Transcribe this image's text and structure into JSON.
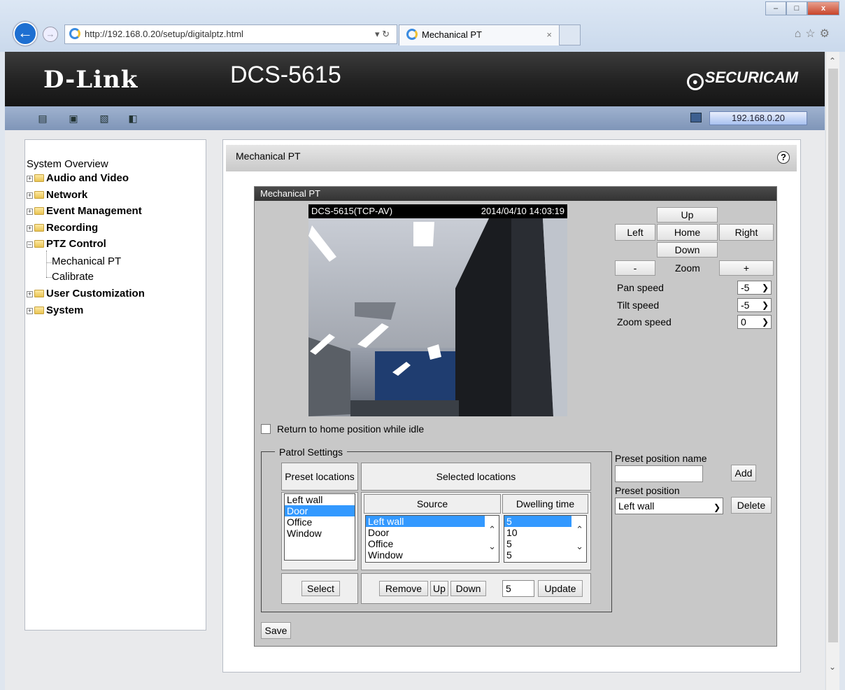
{
  "browser": {
    "url": "http://192.168.0.20/setup/digitalptz.html",
    "tab_title": "Mechanical PT",
    "win_min": "–",
    "win_max": "□",
    "win_close": "x"
  },
  "header": {
    "logo": "D-Link",
    "model": "DCS-5615",
    "brand": "SECURICAM",
    "ip": "192.168.0.20"
  },
  "sidebar": {
    "overview": "System Overview",
    "items": [
      {
        "label": "Audio and Video"
      },
      {
        "label": "Network"
      },
      {
        "label": "Event Management"
      },
      {
        "label": "Recording"
      },
      {
        "label": "PTZ Control"
      },
      {
        "label": "User Customization"
      },
      {
        "label": "System"
      }
    ],
    "ptz_children": [
      "Mechanical PT",
      "Calibrate"
    ]
  },
  "main": {
    "outer_title": "Mechanical PT",
    "inner_title": "Mechanical PT",
    "help": "?",
    "video_label": "DCS-5615(TCP-AV)",
    "video_time": "2014/04/10 14:03:19",
    "return_home_label": "Return to home position while idle",
    "return_home_checked": false,
    "save": "Save"
  },
  "ptz": {
    "up": "Up",
    "left": "Left",
    "home": "Home",
    "right": "Right",
    "down": "Down",
    "zoom_out": "-",
    "zoom_label": "Zoom",
    "zoom_in": "+",
    "pan_speed_label": "Pan speed",
    "pan_speed": "-5",
    "tilt_speed_label": "Tilt speed",
    "tilt_speed": "-5",
    "zoom_speed_label": "Zoom speed",
    "zoom_speed": "0"
  },
  "patrol": {
    "legend": "Patrol Settings",
    "preset_locations_header": "Preset locations",
    "selected_locations_header": "Selected locations",
    "source_header": "Source",
    "dwelling_header": "Dwelling time",
    "preset_list": [
      "Left wall",
      "Door",
      "Office",
      "Window"
    ],
    "preset_selected": "Door",
    "source_list": [
      "Left wall",
      "Door",
      "Office",
      "Window"
    ],
    "source_selected": "Left wall",
    "dwell_list": [
      "5",
      "10",
      "5",
      "5"
    ],
    "dwell_selected": "5",
    "select": "Select",
    "remove": "Remove",
    "up": "Up",
    "down": "Down",
    "dwell_input": "5",
    "update": "Update"
  },
  "preset": {
    "name_label": "Preset position name",
    "name_value": "",
    "add": "Add",
    "position_label": "Preset position",
    "position_value": "Left wall",
    "delete": "Delete"
  }
}
